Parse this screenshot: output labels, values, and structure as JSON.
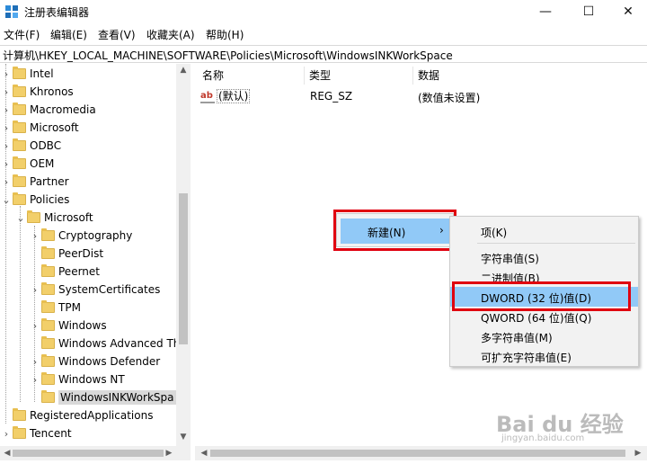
{
  "window": {
    "title": "注册表编辑器",
    "controls": {
      "minimize": "—",
      "maximize": "☐",
      "close": "✕"
    }
  },
  "menubar": [
    {
      "label": "文件(F)"
    },
    {
      "label": "编辑(E)"
    },
    {
      "label": "查看(V)"
    },
    {
      "label": "收藏夹(A)"
    },
    {
      "label": "帮助(H)"
    }
  ],
  "address": "计算机\\HKEY_LOCAL_MACHINE\\SOFTWARE\\Policies\\Microsoft\\WindowsINKWorkSpace",
  "tree": {
    "items": [
      {
        "label": "Intel",
        "expander": "›"
      },
      {
        "label": "Khronos",
        "expander": "›"
      },
      {
        "label": "Macromedia",
        "expander": "›"
      },
      {
        "label": "Microsoft",
        "expander": "›"
      },
      {
        "label": "ODBC",
        "expander": "›"
      },
      {
        "label": "OEM",
        "expander": "›"
      },
      {
        "label": "Partner",
        "expander": "›"
      },
      {
        "label": "Policies",
        "expander": "⌄"
      },
      {
        "label": "Microsoft",
        "expander": "⌄"
      },
      {
        "label": "Cryptography",
        "expander": "›"
      },
      {
        "label": "PeerDist",
        "expander": ""
      },
      {
        "label": "Peernet",
        "expander": ""
      },
      {
        "label": "SystemCertificates",
        "expander": "›"
      },
      {
        "label": "TPM",
        "expander": ""
      },
      {
        "label": "Windows",
        "expander": "›"
      },
      {
        "label": "Windows Advanced Th",
        "expander": ""
      },
      {
        "label": "Windows Defender",
        "expander": "›"
      },
      {
        "label": "Windows NT",
        "expander": "›"
      },
      {
        "label": "WindowsINKWorkSpa",
        "expander": "",
        "selected": true
      },
      {
        "label": "RegisteredApplications",
        "expander": ""
      },
      {
        "label": "Tencent",
        "expander": "›"
      }
    ]
  },
  "list": {
    "columns": {
      "name": "名称",
      "type": "类型",
      "data": "数据"
    },
    "rows": [
      {
        "icon": "ab",
        "name": "(默认)",
        "type": "REG_SZ",
        "data": "(数值未设置)"
      }
    ]
  },
  "context_menu": {
    "item": "新建(N)",
    "arrow": "›",
    "submenu": [
      {
        "label": "项(K)"
      },
      {
        "label": "字符串值(S)"
      },
      {
        "label": "二进制值(B)"
      },
      {
        "label": "DWORD (32 位)值(D)"
      },
      {
        "label": "QWORD (64 位)值(Q)"
      },
      {
        "label": "多字符串值(M)"
      },
      {
        "label": "可扩充字符串值(E)"
      }
    ]
  },
  "watermark": {
    "logo": "Bai du 经验",
    "url": "jingyan.baidu.com"
  },
  "colors": {
    "highlight": "#91c9f7",
    "annotation_red": "#e0000f",
    "folder": "#f2cf6a"
  }
}
